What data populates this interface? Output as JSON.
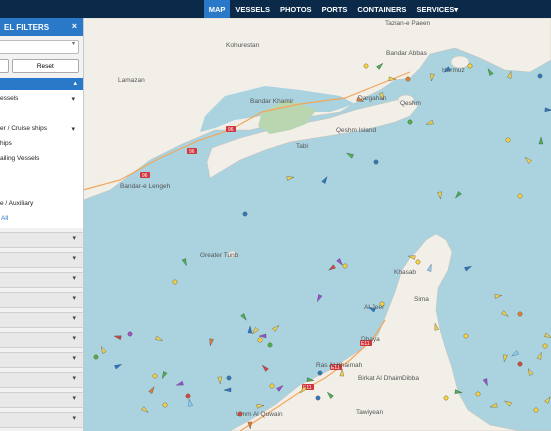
{
  "topbar": {
    "nav": [
      {
        "id": "map",
        "label": "MAP",
        "active": true
      },
      {
        "id": "vessels",
        "label": "VESSELS",
        "active": false
      },
      {
        "id": "photos",
        "label": "PHOTOS",
        "active": false
      },
      {
        "id": "ports",
        "label": "PORTS",
        "active": false
      },
      {
        "id": "containers",
        "label": "CONTAINERS",
        "active": false
      },
      {
        "id": "services",
        "label": "SERVICES▾",
        "active": false
      }
    ]
  },
  "panel": {
    "title": "EL FILTERS",
    "close_icon": "×",
    "reset_label": "Reset",
    "vessel_types": [
      {
        "label": "essels",
        "has_children": true
      },
      {
        "label": "",
        "has_children": false
      },
      {
        "label": "er / Cruise ships",
        "has_children": true
      },
      {
        "label": "hips",
        "has_children": false
      },
      {
        "label": "ailing Vessels",
        "has_children": false
      },
      {
        "label": "",
        "has_children": false
      },
      {
        "label": "",
        "has_children": false
      },
      {
        "label": "e / Auxiliary",
        "has_children": false
      }
    ],
    "all_link": "All",
    "collapsed_section_count": 11
  },
  "map": {
    "places": [
      {
        "name": "Bandar Abbas"
      },
      {
        "name": "Kohurestan"
      },
      {
        "name": "Lamazan"
      },
      {
        "name": "Bandar Khamir"
      },
      {
        "name": "Qeshm Island"
      },
      {
        "name": "Dargahan"
      },
      {
        "name": "Qeshm"
      },
      {
        "name": "Hormuz"
      },
      {
        "name": "Tabl"
      },
      {
        "name": "Bandar-e Lengeh"
      },
      {
        "name": "Greater Tunb"
      },
      {
        "name": "Khasab"
      },
      {
        "name": "Sima"
      },
      {
        "name": "Al Jeer"
      },
      {
        "name": "Dhaya"
      },
      {
        "name": "Ras Al Khaimah"
      },
      {
        "name": "Birkat Al Dhaim"
      },
      {
        "name": "Umm Al Quwain"
      },
      {
        "name": "Dibba"
      },
      {
        "name": "Tawiyean"
      },
      {
        "name": "Tazian-e Paeen"
      }
    ],
    "road_labels": [
      "96",
      "96",
      "96",
      "E11",
      "E11",
      "E11"
    ],
    "colors": {
      "sea": "#aad3df",
      "land": "#f2efe9",
      "topbar": "#0b2a4a",
      "accent": "#2a78c8"
    }
  }
}
